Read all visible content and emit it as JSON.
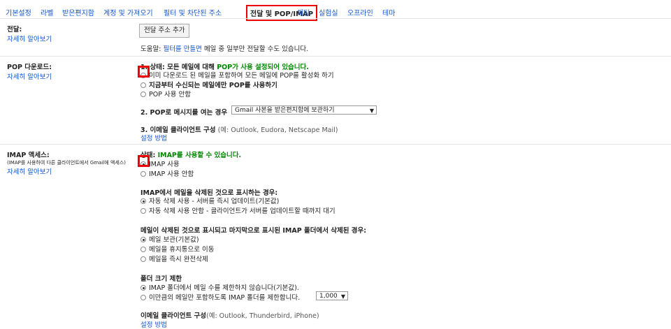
{
  "tabs": [
    {
      "label": "기본설정"
    },
    {
      "label": "라벨"
    },
    {
      "label": "받은편지함"
    },
    {
      "label": "계정 및 가져오기"
    },
    {
      "label": "필터 및 차단된 주소"
    },
    {
      "label": "전달 및 POP/IMAP"
    },
    {
      "label": "채팅"
    },
    {
      "label": "실험실"
    },
    {
      "label": "오프라인"
    },
    {
      "label": "테마"
    }
  ],
  "forwarding": {
    "title": "전달:",
    "learn_more": "자세히 알아보기",
    "add_button": "전달 주소 추가",
    "tip_prefix": "도움말: ",
    "tip_link": "필터를 만들면",
    "tip_suffix": " 메일 중 일부만 전달할 수도 있습니다."
  },
  "pop": {
    "title": "POP 다운로드:",
    "learn_more": "자세히 알아보기",
    "status_prefix": "1. 상태: 모든 메일에 대해 ",
    "status_value": "POP가 사용 설정되어 있습니다.",
    "option1": "이미 다운로드 된 메일을 포함하여 모든 메일에 POP를 활성화 하기",
    "option2": "지금부터 수신되는 메일에만 POP를 사용하기",
    "option3": "POP 사용 안함",
    "q2_label": "2. POP로 메시지를 여는 경우",
    "q2_select": "Gmail 사본을 받은편지함에 보관하기",
    "q3_label": "3. 이메일 클라이언트 구성",
    "q3_example": " (예: Outlook, Eudora, Netscape Mail)",
    "q3_link": "설정 방법"
  },
  "imap": {
    "title": "IMAP 액세스:",
    "desc": "(IMAP를 사용하여 다른 클라이언트에서 Gmail에 액세스)",
    "learn_more": "자세히 알아보기",
    "status_prefix": "상태: ",
    "status_value": "IMAP를 사용할 수 있습니다.",
    "enable": "IMAP 사용",
    "disable": "IMAP 사용 안함",
    "delete_title": "IMAP에서 메일을 삭제된 것으로 표시하는 경우:",
    "delete_opt1": "자동 삭제 사용 - 서버를 즉시 업데이트(기본값)",
    "delete_opt2": "자동 삭제 사용 안함 - 클라이언트가 서버를 업데이트할 때까지 대기",
    "expunge_title": "메일이 삭제된 것으로 표시되고 마지막으로 표시된 IMAP 폴더에서 삭제된 경우:",
    "expunge_opt1": "메일 보관(기본값)",
    "expunge_opt2": "메일을 휴지통으로 이동",
    "expunge_opt3": "메일을 즉시 완전삭제",
    "folder_title": "폴더 크기 제한",
    "folder_opt1": "IMAP 폴더에서 메일 수를 제한하지 않습니다(기본값).",
    "folder_opt2": "이만큼의 메일만 포함하도록 IMAP 폴더를 제한합니다.",
    "folder_select": "1,000",
    "client_label": "이메일 클라이언트 구성",
    "client_example": "(예: Outlook, Thunderbird, iPhone)",
    "client_link": "설정 방법"
  }
}
